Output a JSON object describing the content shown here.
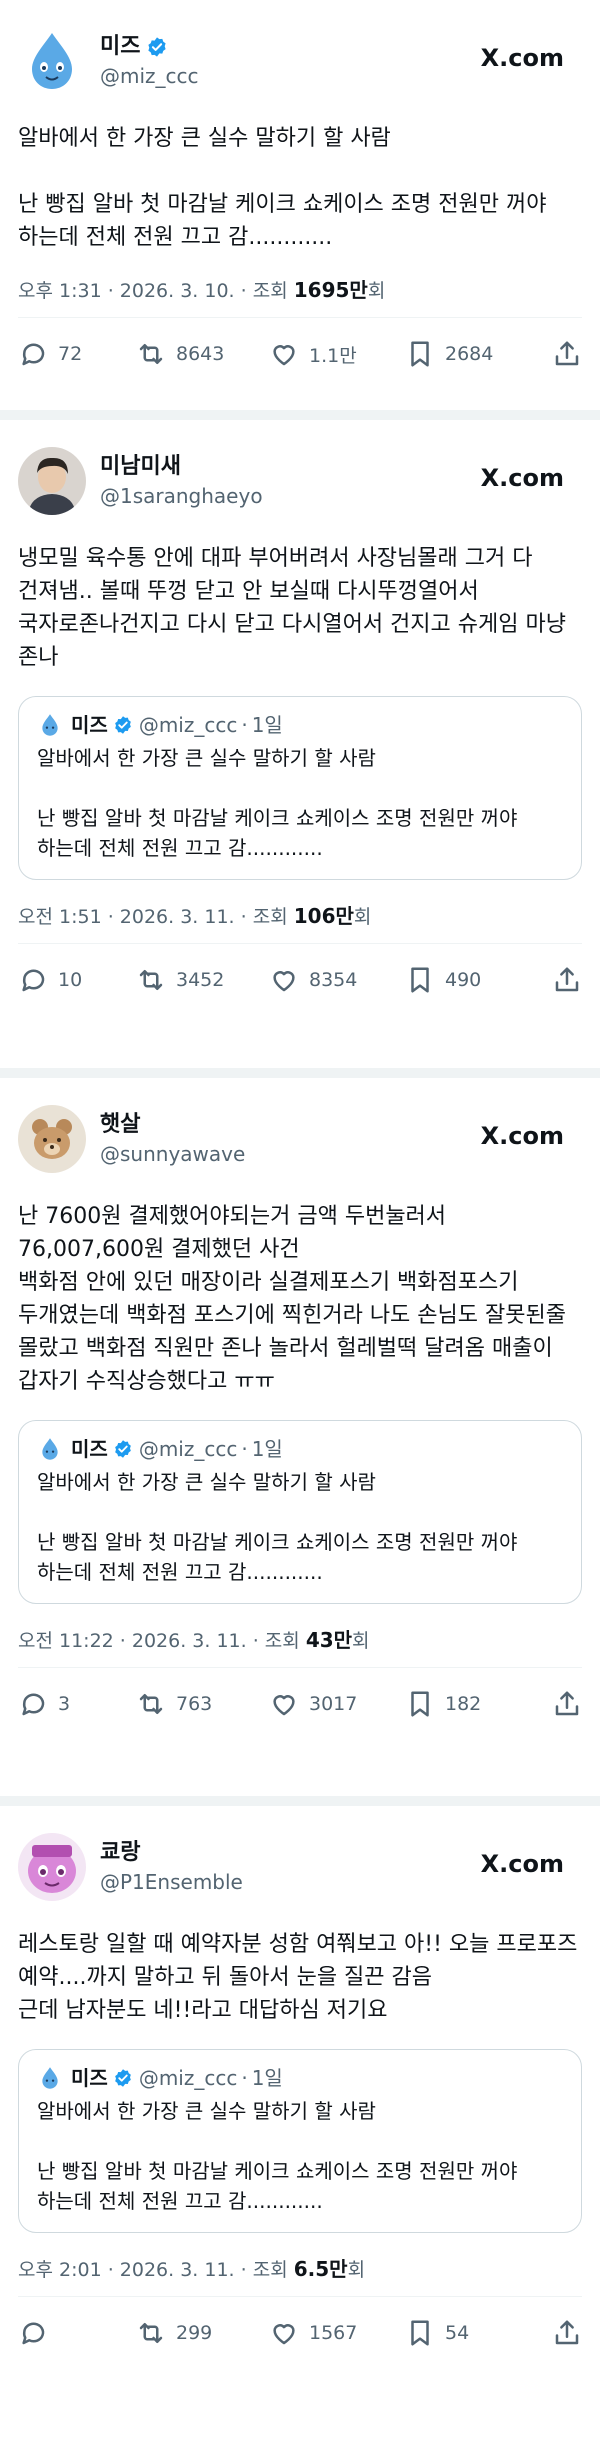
{
  "brand": "X.com",
  "tweets": [
    {
      "name": "미즈",
      "verified": true,
      "handle": "@miz_ccc",
      "text": "알바에서 한 가장 큰 실수 말하기 할 사람\n\n난 빵집 알바 첫 마감날 케이크 쇼케이스 조명 전원만 꺼야 하는데 전체 전원 끄고 감............",
      "meta_prefix": "오후 1:31 · 2026. 3. 10. · 조회 ",
      "views": "1695만",
      "views_suffix": "회",
      "replies": "72",
      "retweets": "8643",
      "likes": "1.1만",
      "bookmarks": "2684"
    },
    {
      "name": "미남미새",
      "handle": "@1saranghaeyo",
      "text": "냉모밀 육수통 안에 대파 부어버려서 사장님몰래 그거 다 건져냄.. 볼때 뚜껑 닫고 안 보실때 다시뚜껑열어서 국자로존나건지고 다시 닫고 다시열어서 건지고 슈게임 마냥 존나",
      "quote": {
        "name": "미즈",
        "handle": "@miz_ccc",
        "time": "1일",
        "text": "알바에서 한 가장 큰 실수 말하기 할 사람\n\n난 빵집 알바 첫 마감날 케이크 쇼케이스 조명 전원만 꺼야 하는데 전체 전원 끄고 감............"
      },
      "meta_prefix": "오전 1:51 · 2026. 3. 11. · 조회 ",
      "views": "106만",
      "views_suffix": "회",
      "replies": "10",
      "retweets": "3452",
      "likes": "8354",
      "bookmarks": "490"
    },
    {
      "name": "햇살",
      "handle": "@sunnyawave",
      "text": "난 7600원 결제했어야되는거 금액 두번눌러서 76,007,600원 결제했던 사건\n백화점 안에 있던 매장이라 실결제포스기 백화점포스기 두개였는데 백화점 포스기에 찍힌거라 나도 손님도 잘못된줄 몰랐고 백화점 직원만 존나 놀라서 헐레벌떡 달려옴 매출이 갑자기 수직상승했다고 ㅠㅠ",
      "quote": {
        "name": "미즈",
        "handle": "@miz_ccc",
        "time": "1일",
        "text": "알바에서 한 가장 큰 실수 말하기 할 사람\n\n난 빵집 알바 첫 마감날 케이크 쇼케이스 조명 전원만 꺼야 하는데 전체 전원 끄고 감............"
      },
      "meta_prefix": "오전 11:22 · 2026. 3. 11. · 조회 ",
      "views": "43만",
      "views_suffix": "회",
      "replies": "3",
      "retweets": "763",
      "likes": "3017",
      "bookmarks": "182"
    },
    {
      "name": "쿄랑",
      "handle": "@P1Ensemble",
      "text": "레스토랑 일할 때 예약자분 성함 여쭤보고 아!! 오늘 프로포즈 예약....까지 말하고 뒤 돌아서 눈을 질끈 감음\n근데 남자분도 네!!라고 대답하심 저기요",
      "quote": {
        "name": "미즈",
        "handle": "@miz_ccc",
        "time": "1일",
        "text": "알바에서 한 가장 큰 실수 말하기 할 사람\n\n난 빵집 알바 첫 마감날 케이크 쇼케이스 조명 전원만 꺼야 하는데 전체 전원 끄고 감............"
      },
      "meta_prefix": "오후 2:01 · 2026. 3. 11. · 조회 ",
      "views": "6.5만",
      "views_suffix": "회",
      "replies": "",
      "retweets": "299",
      "likes": "1567",
      "bookmarks": "54"
    }
  ],
  "colors": {
    "text": "#0f1419",
    "muted": "#536471",
    "verified": "#1d9bf0",
    "border": "#cfd9de"
  },
  "icons": [
    "reply-icon",
    "retweet-icon",
    "like-icon",
    "bookmark-icon",
    "share-icon",
    "verified-badge-icon"
  ]
}
